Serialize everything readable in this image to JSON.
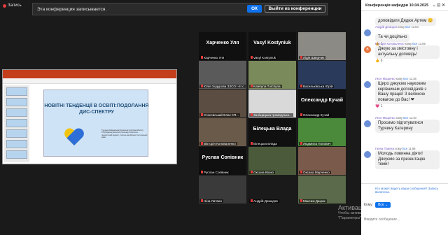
{
  "top_left": {
    "rec_label": "Запись"
  },
  "banner": {
    "text": "Эта конференция записывается.",
    "ok": "ОК",
    "leave": "Выйти из конференции",
    "close": "×"
  },
  "slide": {
    "title": "НОВІТНІ ТЕНДЕНЦІЇ В ОСВІТІ:ПОДОЛАННЯ ДИС-СПЕКТРУ",
    "author": "Турчина (Шиманська) Катерина Сергіївна Магістр ЛТЗ(Україна) Selecpol (Польща) Психолого-педагогічний педагог, учитель англійської та польської мови"
  },
  "tiles": [
    {
      "name": "Харченко Уля",
      "caption": "Харченко Уля",
      "bg": "#101010",
      "show_name": true
    },
    {
      "name": "Vasyl Kostyniuk",
      "caption": "Vasyl Kostyniuk",
      "bg": "#101010",
      "show_name": true
    },
    {
      "name": "",
      "caption": "Лідія Шведчик",
      "bg": "#8c8a84",
      "show_name": false
    },
    {
      "name": "",
      "caption": "Юлія Ходурова ЗЗСО І-III с...",
      "bg": "#5a5a5a",
      "show_name": false
    },
    {
      "name": "",
      "caption": "Kateryna Turchyna",
      "bg": "#7a8a5a",
      "show_name": false
    },
    {
      "name": "",
      "caption": "Васильківська Юрій",
      "bg": "#2a3a5a",
      "show_name": false
    },
    {
      "name": "",
      "caption": "Стасевський Влас КП...",
      "bg": "#5b4d42",
      "show_name": false
    },
    {
      "name": "",
      "caption": "Заліщицька громадська...",
      "bg": "#d9d9d9",
      "show_name": false
    },
    {
      "name": "Олександр Кучай",
      "caption": "Олександр Кучай",
      "bg": "#101010",
      "show_name": true
    },
    {
      "name": "",
      "caption": "Вікторія Коноваленко",
      "bg": "#6a5a4a",
      "show_name": false
    },
    {
      "name": "Білецька Влада",
      "caption": "Білецька Влада",
      "bg": "#101010",
      "show_name": true
    },
    {
      "name": "",
      "caption": "Людмила Попович",
      "bg": "#4a8a3a",
      "show_name": false
    },
    {
      "name": "Руслан Сопівник",
      "caption": "Руслан Сопівник",
      "bg": "#101010",
      "show_name": true
    },
    {
      "name": "",
      "caption": "Оксана Квоко",
      "bg": "#4a5a3a",
      "show_name": false
    },
    {
      "name": "",
      "caption": "Оксана Марченко",
      "bg": "#7a5a4a",
      "show_name": false
    },
    {
      "name": "",
      "caption": "Ніна Литвин",
      "bg": "#3a3a3a",
      "show_name": false
    },
    {
      "name": "",
      "caption": "Андрій Демидов",
      "bg": "#1a1a1a",
      "show_name": false
    },
    {
      "name": "",
      "caption": "Максим Дацюк",
      "bg": "#5a6a4a",
      "show_name": false
    }
  ],
  "watermark": {
    "title": "Активация Windows",
    "sub1": "Чтобы активировать Windows, перейдите в раздел",
    "sub2": "\"Параметры\"."
  },
  "chat": {
    "title": "Конференція кафедри 10.04.2025",
    "messages": [
      {
        "text": "доповідати Дядюк Артем 😊"
      },
      {
        "from": "Андрій Демидов",
        "to_word": "кому",
        "to": "Все",
        "time": "11:54",
        "text": "Та чи доцільно",
        "reaction": "👍 1"
      },
      {
        "from": "Вікторія Коноваленко",
        "to_word": "кому",
        "to": "Все",
        "time": "11:55",
        "text": "Дякую за змістовну і актуальну доповідь!",
        "avatar": "В",
        "reaction": "👍 6"
      },
      {
        "from": "Леся Мащенко",
        "to_word": "кому",
        "to": "Все",
        "time": "11:36",
        "text": "Щиро дякуємо науковим керівникам доповідачів з Вашу працю! З великою повагою до Вас! ❤",
        "reaction": "💗 1"
      },
      {
        "from": "Леся Мащенко",
        "to_word": "кому",
        "to": "Все",
        "time": "11:40",
        "text": "Просимо підготуватися Турчину Катерину"
      },
      {
        "from": "Ганна Павлюк",
        "to_word": "кому",
        "to": "Все",
        "time": "11:58",
        "text": "Молодь повинна діяти! Дякуємо за презентацію теми!"
      }
    ],
    "who_can_see": "Кто может видеть ваши сообщения? Запись включена.",
    "to_label": "Кому:",
    "to_value": "Все",
    "placeholder": "Введите сообщение…"
  }
}
